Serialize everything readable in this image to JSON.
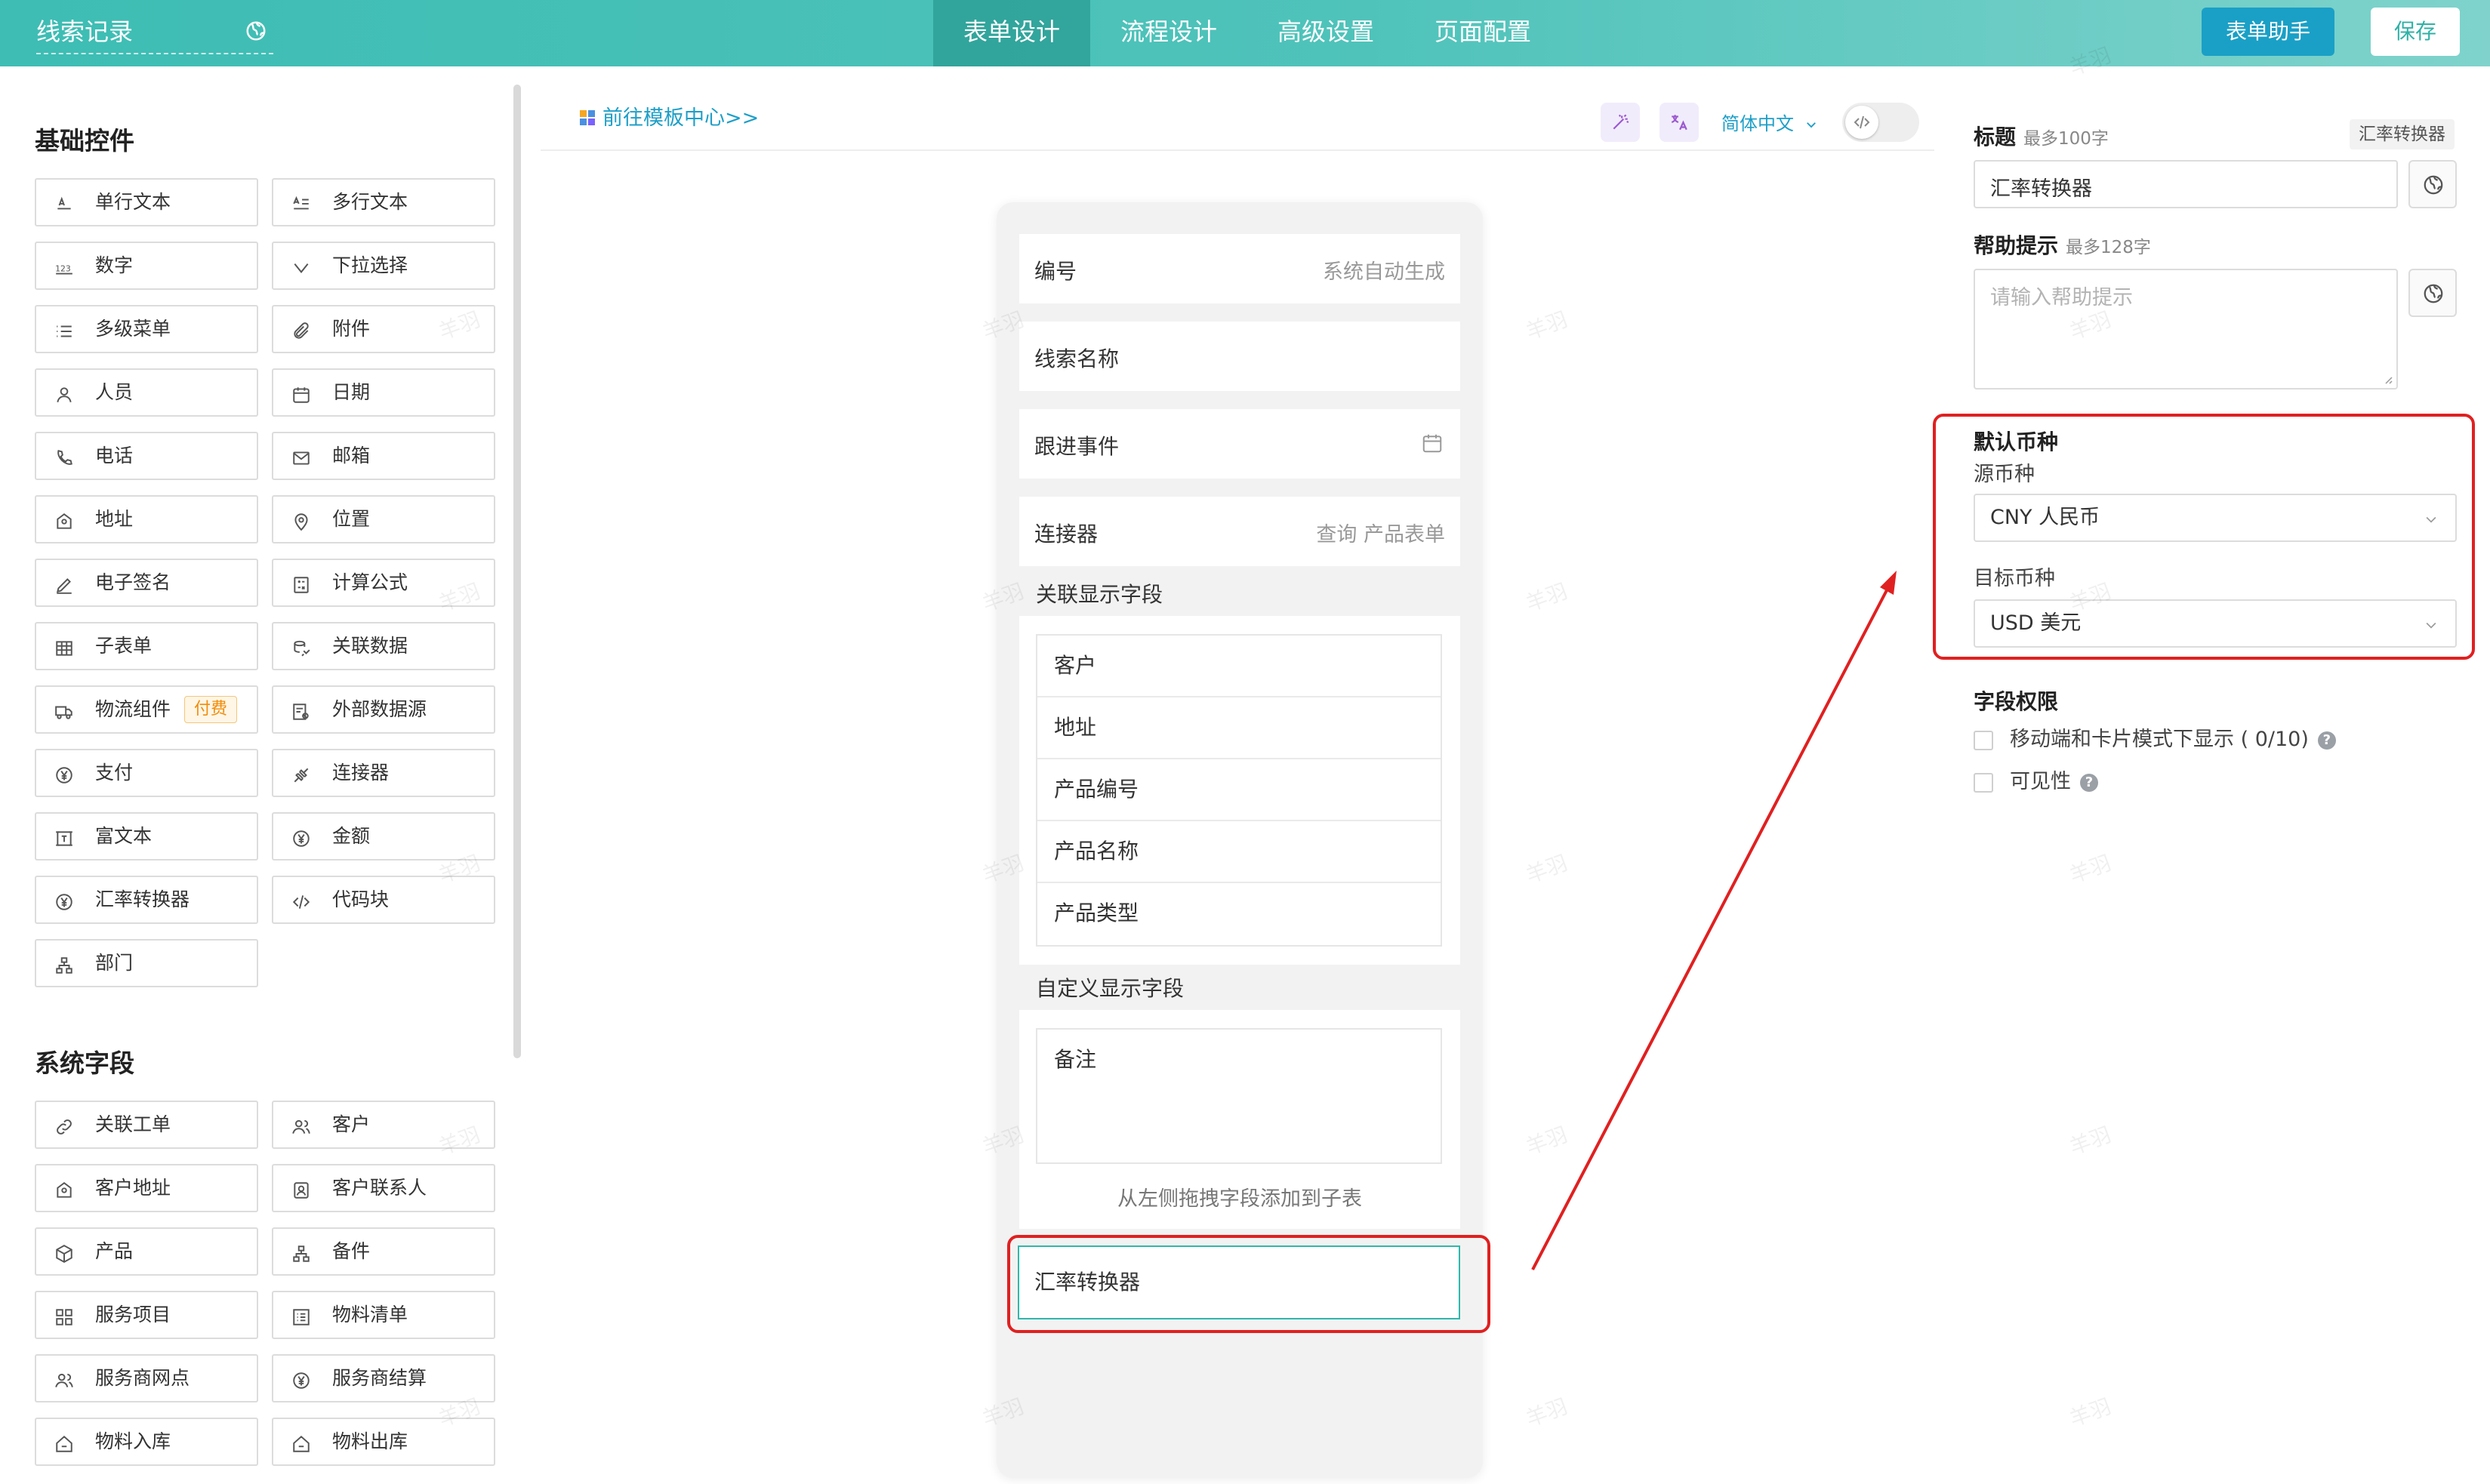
{
  "header": {
    "app_title": "线索记录",
    "tabs": [
      {
        "label": "表单设计",
        "active": true
      },
      {
        "label": "流程设计",
        "active": false
      },
      {
        "label": "高级设置",
        "active": false
      },
      {
        "label": "页面配置",
        "active": false
      }
    ],
    "assistant_label": "表单助手",
    "save_label": "保存"
  },
  "palette": {
    "basic_title": "基础控件",
    "basic_items": [
      {
        "label": "单行文本",
        "icon": "single-line-text-icon"
      },
      {
        "label": "多行文本",
        "icon": "multi-line-text-icon"
      },
      {
        "label": "数字",
        "icon": "number-icon"
      },
      {
        "label": "下拉选择",
        "icon": "chevron-down-icon"
      },
      {
        "label": "多级菜单",
        "icon": "list-icon"
      },
      {
        "label": "附件",
        "icon": "paperclip-icon"
      },
      {
        "label": "人员",
        "icon": "person-icon"
      },
      {
        "label": "日期",
        "icon": "calendar-icon"
      },
      {
        "label": "电话",
        "icon": "phone-icon"
      },
      {
        "label": "邮箱",
        "icon": "mail-icon"
      },
      {
        "label": "地址",
        "icon": "address-icon"
      },
      {
        "label": "位置",
        "icon": "location-pin-icon"
      },
      {
        "label": "电子签名",
        "icon": "pen-icon"
      },
      {
        "label": "计算公式",
        "icon": "calculator-icon"
      },
      {
        "label": "子表单",
        "icon": "table-icon"
      },
      {
        "label": "关联数据",
        "icon": "linked-data-icon"
      },
      {
        "label": "物流组件",
        "icon": "truck-icon",
        "badge": "付费"
      },
      {
        "label": "外部数据源",
        "icon": "external-data-icon"
      },
      {
        "label": "支付",
        "icon": "yuan-circle-icon"
      },
      {
        "label": "连接器",
        "icon": "connector-icon"
      },
      {
        "label": "富文本",
        "icon": "rich-text-icon"
      },
      {
        "label": "金额",
        "icon": "yuan-circle-icon"
      },
      {
        "label": "汇率转换器",
        "icon": "yuan-circle-icon"
      },
      {
        "label": "代码块",
        "icon": "code-icon"
      },
      {
        "label": "部门",
        "icon": "org-chart-icon"
      }
    ],
    "system_title": "系统字段",
    "system_items": [
      {
        "label": "关联工单",
        "icon": "link-icon"
      },
      {
        "label": "客户",
        "icon": "users-icon"
      },
      {
        "label": "客户地址",
        "icon": "address-icon"
      },
      {
        "label": "客户联系人",
        "icon": "contact-icon"
      },
      {
        "label": "产品",
        "icon": "box-icon"
      },
      {
        "label": "备件",
        "icon": "org-chart-icon"
      },
      {
        "label": "服务项目",
        "icon": "grid-icon"
      },
      {
        "label": "物料清单",
        "icon": "list-box-icon"
      },
      {
        "label": "服务商网点",
        "icon": "users-icon"
      },
      {
        "label": "服务商结算",
        "icon": "yuan-circle-icon"
      },
      {
        "label": "物料入库",
        "icon": "house-icon"
      },
      {
        "label": "物料出库",
        "icon": "house-icon"
      }
    ]
  },
  "canvas": {
    "template_link": "前往模板中心>>",
    "language": "简体中文",
    "fields": [
      {
        "label": "编号",
        "value": "系统自动生成"
      },
      {
        "label": "线索名称",
        "value": ""
      },
      {
        "label": "跟进事件",
        "value": ""
      },
      {
        "label": "连接器",
        "value": "查询 产品表单"
      }
    ],
    "related_display_label": "关联显示字段",
    "related_rows": [
      "客户",
      "地址",
      "产品编号",
      "产品名称",
      "产品类型"
    ],
    "custom_display_label": "自定义显示字段",
    "custom_rows": [
      "备注"
    ],
    "drop_hint": "从左侧拖拽字段添加到子表",
    "selected_field": "汇率转换器"
  },
  "properties": {
    "title_label": "标题",
    "title_hint": "最多100字",
    "field_type_tag": "汇率转换器",
    "title_value": "汇率转换器",
    "help_label": "帮助提示",
    "help_hint": "最多128字",
    "help_placeholder": "请输入帮助提示",
    "currency_section": "默认币种",
    "source_label": "源币种",
    "source_value": "CNY 人民币",
    "target_label": "目标币种",
    "target_value": "USD 美元",
    "permission_label": "字段权限",
    "perm_mobile": "移动端和卡片模式下显示 ( 0/10)",
    "perm_visible": "可见性"
  },
  "watermark_text": "羊羽",
  "colors": {
    "brand_teal": "#3dbdb4",
    "assistant_blue": "#1aa0c6",
    "highlight_red": "#e02020",
    "link_blue": "#1e9fc8",
    "paid_orange": "#f08c0a"
  }
}
